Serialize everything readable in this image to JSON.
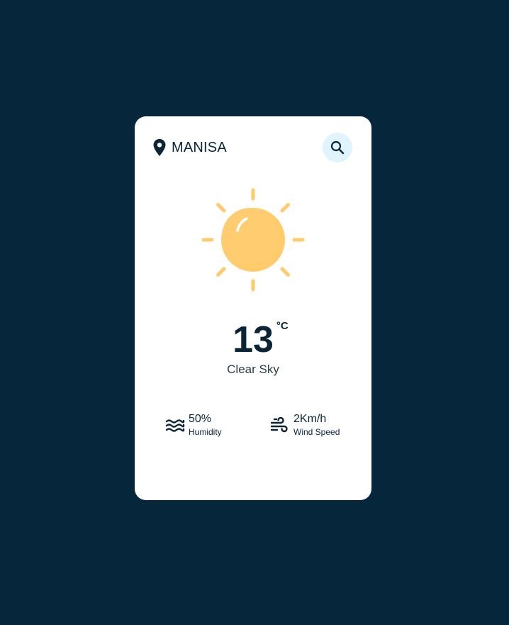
{
  "location": {
    "city": "MANISA",
    "icon": "map-pin-icon"
  },
  "search": {
    "icon": "search-icon"
  },
  "weather": {
    "icon": "sun-icon",
    "temperature": "13",
    "unit": "°C",
    "description": "Clear Sky"
  },
  "stats": {
    "humidity": {
      "value": "50%",
      "label": "Humidity",
      "icon": "waves-icon"
    },
    "wind": {
      "value": "2Km/h",
      "label": "Wind Speed",
      "icon": "wind-icon"
    }
  },
  "colors": {
    "background": "#05263b",
    "card": "#ffffff",
    "text": "#0b2537",
    "accent_search": "#dff4fc",
    "sun": "#ffcb6b"
  }
}
